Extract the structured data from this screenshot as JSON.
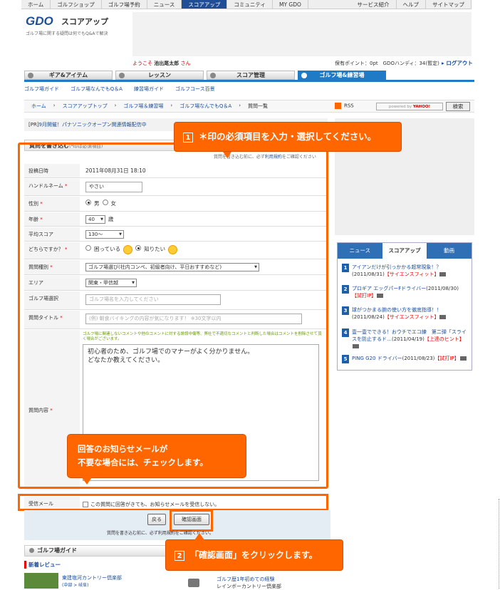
{
  "topnav": [
    "ホーム",
    "ゴルフショップ",
    "ゴルフ場予約",
    "ニュース",
    "スコアアップ",
    "コミュニティ",
    "MY GDO",
    "サービス紹介",
    "ヘルプ",
    "サイトマップ"
  ],
  "logo": {
    "text": "GDO",
    "sub": "スコアアップ",
    "tagline": "ゴルフ場に関する疑問は何でもQ&Aで解決"
  },
  "user": {
    "welcome": "ようこそ",
    "name": "池出尾太郎",
    "suffix": "さん",
    "points": "保有ポイント：0pt　GDOハンディ：34(暫定)",
    "logout": "ログアウト"
  },
  "cattabs": [
    "ギア&アイテム",
    "レッスン",
    "スコア管理",
    "ゴルフ場&練習場"
  ],
  "subnav": [
    "ゴルフ場ガイド",
    "ゴルフ場なんでもQ＆A",
    "練習場ガイド",
    "ゴルフコース百景"
  ],
  "crumbs": [
    "ホーム",
    "スコアアップトップ",
    "ゴルフ場＆練習場",
    "ゴルフ場なんでもQ＆A",
    "質問一覧"
  ],
  "rss": "RSS",
  "search": {
    "powered": "powered by ",
    "yahoo": "YAHOO!",
    "button": "検索"
  },
  "pr": {
    "tag": "[PR]",
    "text": "9月開催！パナソニックオープン関連情報配信中"
  },
  "form": {
    "title": "質問を書き込む",
    "note": "(*印は必須項目)",
    "topnote_pre": "質問を書き込む前に、必ず",
    "topnote_link": "利用規約",
    "topnote_post": "をご確認ください",
    "posted_label": "投稿日時",
    "posted_value": "2011年08月31日 18:10",
    "handle_label": "ハンドルネーム",
    "handle_value": "やさい",
    "sex_label": "性別",
    "sex_male": "男",
    "sex_female": "女",
    "age_label": "年齢",
    "age_value": "40",
    "age_unit": "歳",
    "score_label": "平均スコア",
    "score_value": "130〜",
    "which_label": "どちらですか？",
    "which_a": "困っている",
    "which_b": "知りたい",
    "qtype_label": "質問種別",
    "qtype_value": "ゴルフ場選び(社内コンペ、初級者向け、平日おすすめなど)",
    "area_label": "エリア",
    "area_value": "関東・甲信越",
    "course_label": "ゴルフ場選択",
    "course_placeholder": "ゴルフ場名を入力してください",
    "qtitle_label": "質問タイトル",
    "qtitle_placeholder": "(例) 朝食バイキングの内容が気になります！ ※30文字以内",
    "content_label": "質問内容",
    "warning": "ゴルフ場に関連しないコメントや他のコメントに対する誹謗中傷等、弊社で不適切なコメントと判断した場合はコメントを削除させて頂く場合がございます。",
    "content_text": "初心者のため、ゴルフ場でのマナーがよく分かりません。\nどなたか教えてください。",
    "mail_label": "受信メール",
    "mail_text": "この質問に回答がきても、お知らせメールを受信しない。",
    "back": "戻る",
    "confirm": "確認画面",
    "btn_note": "質問を書き込む前に、必ず利用規約をご確認ください。",
    "req": "*"
  },
  "guide": {
    "title": "ゴルフ場ガイド",
    "newrev": "新着レビュー",
    "rev1": "東建塩河カントリー倶楽部",
    "rev1sub": "(中部 > 岐阜)",
    "rev2": "ゴルフ歴1年初めての経験",
    "rev2sub": "レインボーカントリー倶楽部"
  },
  "news": {
    "tabs": [
      "ニュース",
      "スコアアップ",
      "動画"
    ],
    "items": [
      {
        "n": "1",
        "title": "アイアンだけが引っかかる超常現象！？",
        "date": "(2011/08/31)",
        "tag": "【サイエンスフィット】"
      },
      {
        "n": "2",
        "title": "プロギア エッグパーFドライバー",
        "date": "(2011/08/30)",
        "tag": "【試打IP】"
      },
      {
        "n": "3",
        "title": "球がつかまる腕の使い方を徹底指導！！",
        "date": "(2011/08/24)",
        "tag": "【サイエンスフィット】"
      },
      {
        "n": "4",
        "title": "壹一壹でできる！おウチでエコ練　第二弾「スライスを防止するド…",
        "date": "(2011/04/19)",
        "tag": "【上達のヒント】"
      },
      {
        "n": "5",
        "title": "PING G20 ドライバー",
        "date": "(2011/08/23)",
        "tag": "【試打IP】"
      }
    ]
  },
  "callouts": {
    "c1_num": "1",
    "c1": "＊印の必須項目を入力・選択してください。",
    "c2_num": "2",
    "c2": "「確認画面」をクリックします。",
    "c3_line1": "回答のお知らせメールが",
    "c3_line2": "不要な場合には、チェックします。"
  },
  "colors": {
    "accent": "#ff6600",
    "brand": "#1f4e96",
    "tab": "#1f7bc5"
  }
}
